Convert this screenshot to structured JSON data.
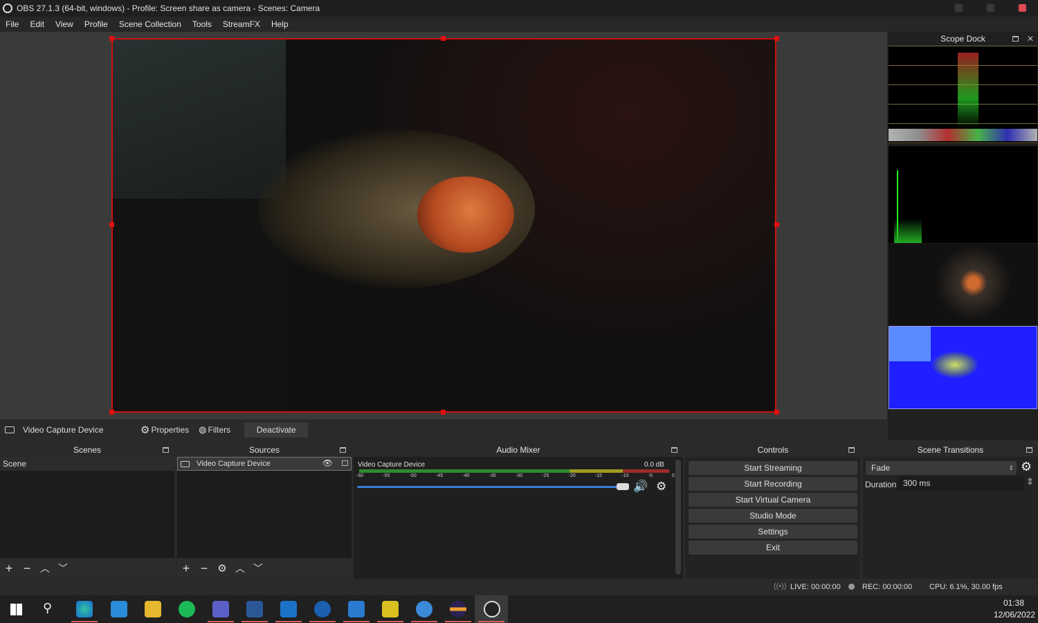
{
  "window": {
    "title": "OBS 27.1.3 (64-bit, windows) - Profile: Screen share as camera - Scenes: Camera"
  },
  "menu": [
    "File",
    "Edit",
    "View",
    "Profile",
    "Scene Collection",
    "Tools",
    "StreamFX",
    "Help"
  ],
  "scope_dock": {
    "title": "Scope Dock"
  },
  "context_bar": {
    "source": "Video Capture Device",
    "properties": "Properties",
    "filters": "Filters",
    "deactivate": "Deactivate"
  },
  "scenes": {
    "title": "Scenes",
    "items": [
      "Scene"
    ]
  },
  "sources": {
    "title": "Sources",
    "items": [
      "Video Capture Device"
    ]
  },
  "mixer": {
    "title": "Audio Mixer",
    "channel": "Video Capture Device",
    "db": "0.0 dB",
    "ticks": [
      "-60",
      "-55",
      "-50",
      "-45",
      "-40",
      "-35",
      "-30",
      "-25",
      "-20",
      "-15",
      "-10",
      "-5",
      "0"
    ]
  },
  "controls": {
    "title": "Controls",
    "buttons": [
      "Start Streaming",
      "Start Recording",
      "Start Virtual Camera",
      "Studio Mode",
      "Settings",
      "Exit"
    ]
  },
  "transitions": {
    "title": "Scene Transitions",
    "selected": "Fade",
    "duration_label": "Duration",
    "duration_value": "300 ms"
  },
  "status": {
    "live": "LIVE: 00:00:00",
    "rec": "REC: 00:00:00",
    "cpu": "CPU: 6.1%, 30.00 fps"
  },
  "clock": {
    "time": "01:38",
    "date": "12/06/2022"
  },
  "colors": {
    "accent_red": "#d01010",
    "scope_blue": "#1f1fff",
    "slider_blue": "#3a7bd5"
  }
}
